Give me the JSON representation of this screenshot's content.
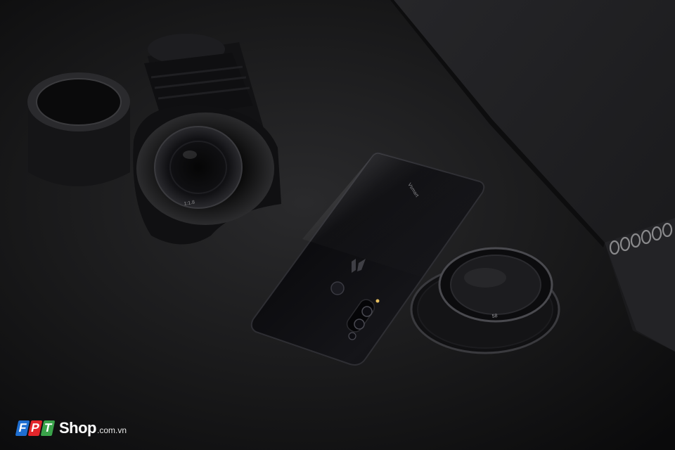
{
  "watermark": {
    "brand_letters": [
      "F",
      "P",
      "T"
    ],
    "shop": "Shop",
    "domain": ".com.vn"
  },
  "lens_markings": {
    "hood_text": "1:1.8",
    "filter_text": "58",
    "phone_brand_text": "Vsmart"
  },
  "colors": {
    "background": "#141415",
    "notebook": "#1e1e21",
    "phone_body": "#0b0b0d",
    "fpt_blue": "#1f6fd1",
    "fpt_red": "#e3262b",
    "fpt_green": "#3aa34a"
  }
}
